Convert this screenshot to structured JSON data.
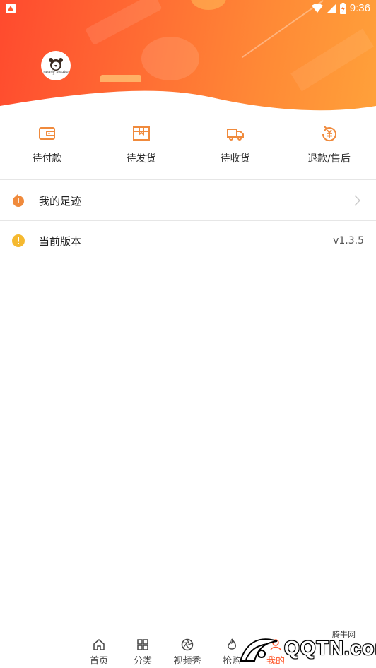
{
  "status_bar": {
    "time": "9:36"
  },
  "profile": {
    "avatar_brand": "nearly awake"
  },
  "orders": [
    {
      "label": "待付款",
      "icon": "wallet-icon"
    },
    {
      "label": "待发货",
      "icon": "package-icon"
    },
    {
      "label": "待收货",
      "icon": "truck-icon"
    },
    {
      "label": "退款/售后",
      "icon": "refund-icon"
    }
  ],
  "menu": {
    "footprints": {
      "label": "我的足迹",
      "icon": "footprint-icon"
    },
    "version": {
      "label": "当前版本",
      "value": "v1.3.5",
      "icon": "info-icon"
    }
  },
  "bottom_nav": [
    {
      "label": "首页",
      "icon": "home-icon"
    },
    {
      "label": "分类",
      "icon": "grid-icon"
    },
    {
      "label": "视频秀",
      "icon": "aperture-icon"
    },
    {
      "label": "抢购",
      "icon": "flame-icon"
    },
    {
      "label": "我的",
      "icon": "user-icon"
    }
  ],
  "watermark": {
    "text": "QQTN.com",
    "cn": "腾牛网"
  },
  "colors": {
    "accent": "#ff5a2e",
    "icon_orange": "#f08a3c",
    "info_yellow": "#f5b930"
  }
}
